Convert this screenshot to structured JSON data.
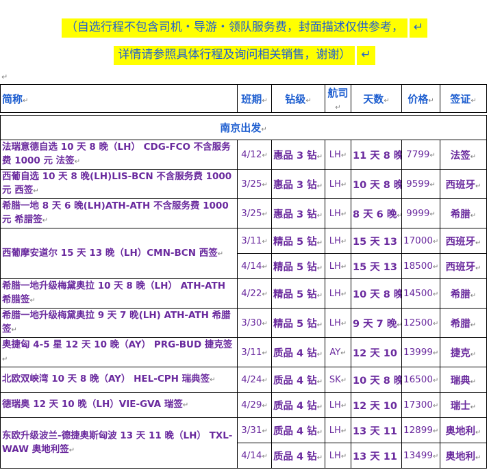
{
  "notice": {
    "line1": "（自选行程不包含司机・导游・领队服务费，封面描述仅供参考，",
    "line2": "详情请参照具体行程及询问相关销售，谢谢）"
  },
  "marks": {
    "para": "↵",
    "cell": "↵"
  },
  "table": {
    "headers": {
      "name": "简称",
      "period": "班期",
      "grade": "钻级",
      "airline": "航司",
      "days": "天数",
      "price": "价格",
      "visa": "签证"
    },
    "city": "南京出发",
    "tours": [
      {
        "name": "法瑞意德自选 10 天 8 晚（LH） CDG-FCO  不含服务费 1000 元 法签",
        "dates": [
          {
            "date": "4/12",
            "grade": "惠品 3 钻",
            "airline": "LH",
            "days": "11 天 8 晚",
            "price": "7799",
            "visa": "法签"
          }
        ]
      },
      {
        "name": "西葡自选 10 天 8 晚(LH)LIS-BCN 不含服务费 1000 元 西签",
        "dates": [
          {
            "date": "3/25",
            "grade": "惠品 3 钻",
            "airline": "LH",
            "days": "10 天 8 晚",
            "price": "9599",
            "visa": "西班牙"
          }
        ]
      },
      {
        "name": "希腊一地 8 天 6 晚(LH)ATH-ATH 不含服务费 1000 元 希腊签",
        "dates": [
          {
            "date": "3/25",
            "grade": "惠品 3 钻",
            "airline": "LH",
            "days": "8 天 6 晚",
            "price": "9999",
            "visa": "希腊"
          }
        ]
      },
      {
        "name": "西葡摩安道尔 15 天 13 晚（LH）CMN-BCN 西签",
        "dates": [
          {
            "date": "3/11",
            "grade": "精品 5 钻",
            "airline": "LH",
            "days": "15 天 13 晚",
            "price": "17000",
            "visa": "西班牙"
          },
          {
            "date": "4/14",
            "grade": "精品 5 钻",
            "airline": "LH",
            "days": "15 天 13 晚",
            "price": "18500",
            "visa": "西班牙"
          }
        ]
      },
      {
        "name": "希腊一地升级梅黛奥拉 10 天 8 晚（LH） ATH-ATH 希腊签",
        "dates": [
          {
            "date": "4/22",
            "grade": "精品 5 钻",
            "airline": "LH",
            "days": "10 天 8 晚",
            "price": "14500",
            "visa": "希腊"
          }
        ]
      },
      {
        "name": "希腊一地升级梅黛奥拉 9 天 7 晚(LH) ATH-ATH 希腊签",
        "dates": [
          {
            "date": "3/30",
            "grade": "精品 5 钻",
            "airline": "LH",
            "days": "9 天 7 晚",
            "price": "12500",
            "visa": "希腊"
          }
        ]
      },
      {
        "name": "奥捷匈 4-5 星 12 天 10 晚（AY） PRG-BUD 捷克签",
        "dates": [
          {
            "date": "3/11",
            "grade": "质品 4 钻",
            "airline": "AY",
            "days": "12 天 10 晚",
            "price": "13999",
            "visa": "捷克"
          }
        ]
      },
      {
        "name": "北欧双峡湾 10 天 8 晚（AY） HEL-CPH 瑞典签",
        "dates": [
          {
            "date": "4/24",
            "grade": "质品 4 钻",
            "airline": "SK",
            "days": "10 天 8 晚",
            "price": "16500",
            "visa": "瑞典"
          }
        ]
      },
      {
        "name": "德瑞奥 12 天 10 晚（LH）VIE-GVA 瑞签",
        "dates": [
          {
            "date": "4/29",
            "grade": "质品 4 钻",
            "airline": "LH",
            "days": "12 天 10 晚",
            "price": "17300",
            "visa": "瑞士"
          }
        ]
      },
      {
        "name": "东欧升级波兰-德捷奥斯匈波 13 天 11 晚（LH） TXL-WAW 奥地利签",
        "dates": [
          {
            "date": "3/31",
            "grade": "质品 4 钻",
            "airline": "LH",
            "days": "13 天 11 晚",
            "price": "12899",
            "visa": "奥地利"
          },
          {
            "date": "4/14",
            "grade": "质品 4 钻",
            "airline": "LH",
            "days": "13 天 11 晚",
            "price": "13499",
            "visa": "奥地利"
          }
        ]
      }
    ]
  }
}
